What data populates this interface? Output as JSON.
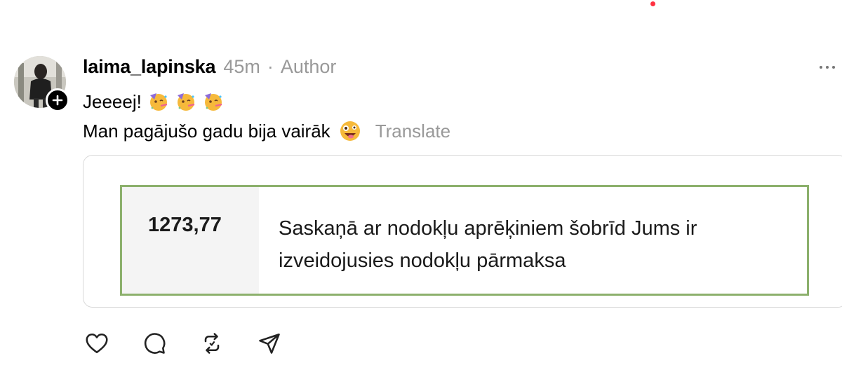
{
  "post": {
    "username": "laima_lapinska",
    "time": "45m",
    "separator": "·",
    "author_badge": "Author",
    "line1": "Jeeeej!",
    "line2": "Man pagājušo gadu bija vairāk",
    "translate": "Translate",
    "emojis_line1": [
      "partying-face-emoji",
      "partying-face-emoji",
      "partying-face-emoji"
    ],
    "emoji_line2": "zany-face-emoji"
  },
  "attachment": {
    "amount": "1273,77",
    "message": "Saskaņā ar nodokļu aprēķiniem šobrīd Jums ir izveidojusies nodokļu pārmaksa",
    "message_line1": "Saskaņā ar nodokļu aprēķiniem šobrīd Jums ir",
    "message_line2": "izveidojusies nodokļu pārmaksa",
    "border_color": "#8cb06c"
  },
  "actions": [
    "heart-icon",
    "comment-icon",
    "repost-icon",
    "share-icon"
  ],
  "colors": {
    "muted_text": "#999999",
    "notification": "#ff3040"
  }
}
